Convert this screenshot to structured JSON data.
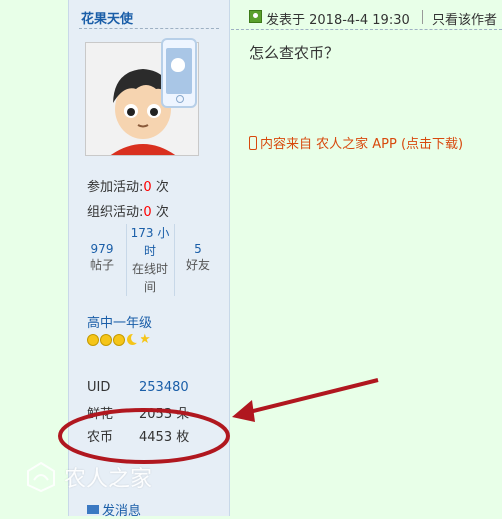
{
  "sidebar": {
    "username": "花果天使",
    "activities": [
      {
        "label": "参加活动:",
        "count": "0",
        "unit": "次"
      },
      {
        "label": "组织活动:",
        "count": "0",
        "unit": "次"
      }
    ],
    "stats": [
      {
        "value": "979",
        "label": "帖子"
      },
      {
        "value": "173 小时",
        "label": "在线时间"
      },
      {
        "value": "5",
        "label": "好友"
      }
    ],
    "rank": "高中一年级",
    "info": [
      {
        "key": "UID",
        "value": "253480"
      },
      {
        "key": "鲜花",
        "value": "2053 朵"
      },
      {
        "key": "农币",
        "value": "4453 枚"
      }
    ],
    "send_message": "发消息"
  },
  "post": {
    "posted_at": "发表于 2018-4-4 19:30",
    "only_author": "只看该作者",
    "content": "怎么查农币？",
    "source": "内容来自 农人之家 APP (点击下载)"
  },
  "watermark": "农人之家",
  "colors": {
    "link": "#1a5ea8",
    "highlight": "#ff0000",
    "source_link": "#d8490d",
    "annotation": "#b0171f",
    "page_bg": "#e8ffe8",
    "sidebar_bg": "#e6eef6"
  }
}
